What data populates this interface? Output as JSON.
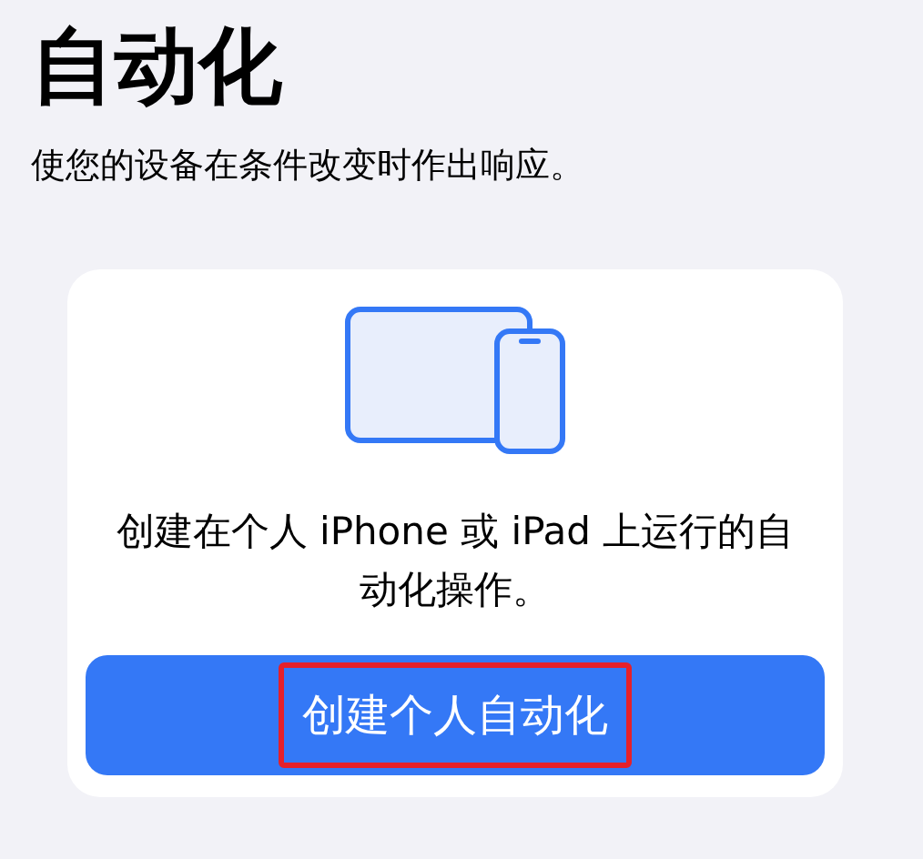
{
  "title": "自动化",
  "subtitle": "使您的设备在条件改变时作出响应。",
  "card": {
    "description": "创建在个人 iPhone 或 iPad 上运行的自动化操作。",
    "button": {
      "label": "创建个人自动化",
      "highlighted": true
    }
  }
}
